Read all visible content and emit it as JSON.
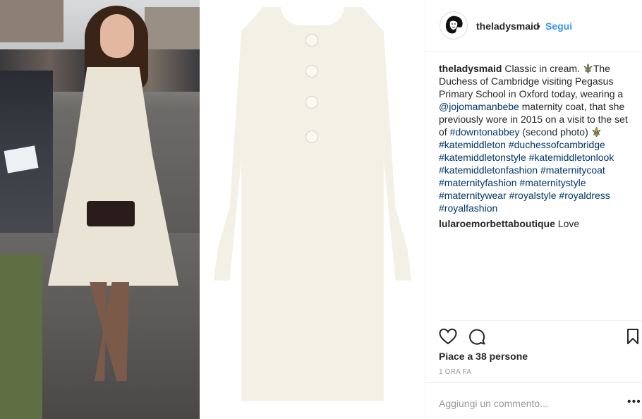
{
  "post": {
    "username": "theladysmaid",
    "separator": "•",
    "follow_label": "Segui",
    "caption": {
      "username": "theladysmaid",
      "part1": " Classic in cream. ",
      "part2": "The Duchess of Cambridge visiting Pegasus Primary School in Oxford today, wearing a ",
      "mention": "@jojomamanbebe",
      "part3": " maternity coat, that she previously wore in 2015 on a visit to the set of ",
      "tag_downton": "#downtonabbey",
      "part4": " (second photo) ",
      "tags": [
        "#katemiddleton",
        "#duchessofcambridge",
        "#katemiddletonstyle",
        "#katemiddletonlook",
        "#katemiddletonfashion",
        "#maternitycoat",
        "#maternityfashion",
        "#maternitystyle",
        "#maternitywear",
        "#royalstyle",
        "#royaldress",
        "#royalfashion"
      ]
    },
    "comments": [
      {
        "username": "lularoemorbettaboutique",
        "text": "Love"
      }
    ],
    "likes": "Piace a 38 persone",
    "time": "1 ORA FA",
    "comment_placeholder": "Aggiungi un commento...",
    "more": "•••"
  },
  "icons": {
    "like": "heart-icon",
    "comment": "comment-bubble-icon",
    "save": "bookmark-icon",
    "emoji": "fleur-de-lis-emoji"
  }
}
